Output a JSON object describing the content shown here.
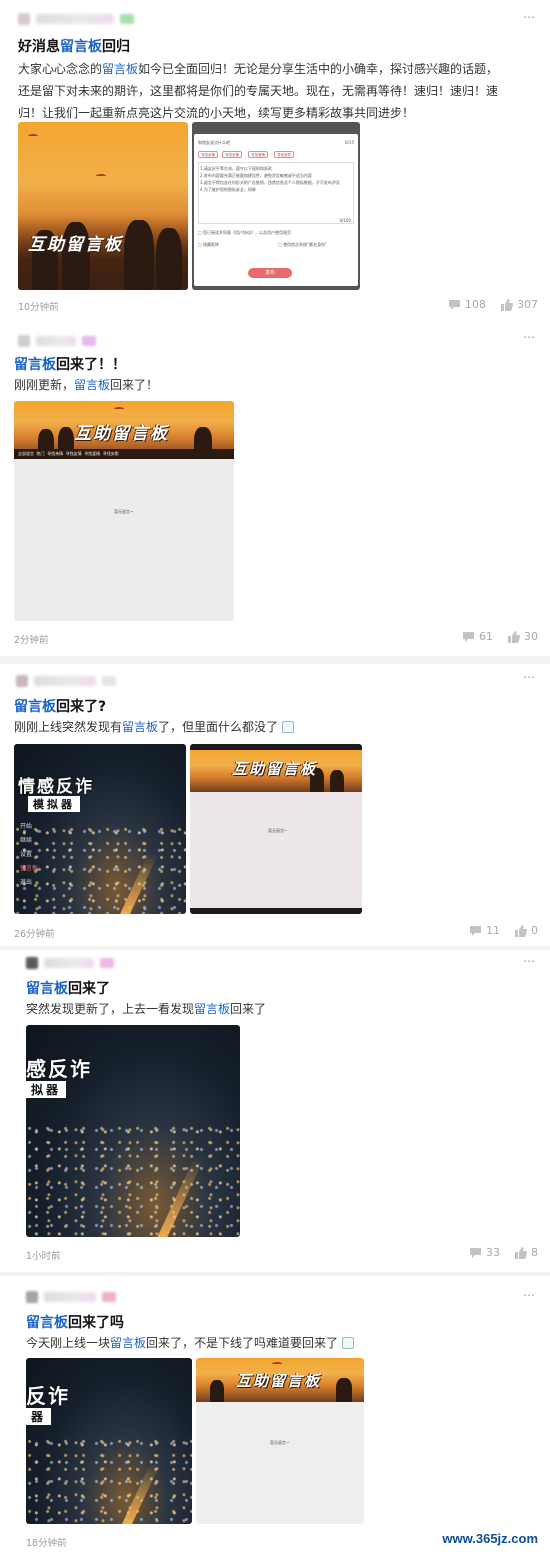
{
  "keyword_color": "#1a63c4",
  "more_icon": "⋯",
  "posts": [
    {
      "title_prefix": "好消息",
      "title_keyword": "留言板",
      "title_suffix": "回归",
      "lines": [
        {
          "a": "大家心心念念的",
          "kw": "留言板",
          "b": "如今已全面回归！无论是分享生活中的小确幸，探讨感兴趣的话题，"
        },
        {
          "a": "还是留下对未来的期许，这里都将是你们的专属天地。现在，无需再等待！速归！速归！速",
          "kw": "",
          "b": ""
        },
        {
          "a": "归！让我们一起重新点亮这片交流的小天地，续写更多精彩故事共同进步！",
          "kw": "",
          "b": ""
        }
      ],
      "images": {
        "poster_text": "互助留言板",
        "form": {
          "placeholder": "和朋友说点什么吧",
          "counter": "0/15",
          "tags": [
            "寻找亲情",
            "寻找友情",
            "寻找爱情",
            "寻找安慰"
          ],
          "text_lines": [
            "1.请友好平等交流，遵守以下规则和条款",
            "2.发布内容要充满正能量和建设性，避免涉及敏感或不适当内容",
            "3.留言不得包含任何形式的广告推销，违禁信息及个人隐私数据，不可发布涉及",
            "4.为了维护您的隐私安全，如果"
          ],
          "char_count": "0/100",
          "note": "□ 您已阅读并同意《用户协议》，以及用户使用规范",
          "anon_label": "□ 允许看到",
          "checkbox_1": "隐藏昵称",
          "checkbox_2": "使用首次系统“匿名身份”",
          "submit": "发布"
        }
      },
      "time": "10分钟前",
      "comments": "108",
      "likes": "307"
    },
    {
      "title_prefix": "",
      "title_keyword": "留言板",
      "title_suffix": "回来了！！",
      "lines": [
        {
          "a": "刚刚更新，",
          "kw": "留言板",
          "b": "回来了！"
        }
      ],
      "images": {
        "poster_text": "互助留言板",
        "tabs": [
          "全部留言",
          "热门",
          "寻找亲情",
          "寻找友情",
          "寻找爱情",
          "寻找安慰"
        ],
        "empty": "暂无留言~"
      },
      "time": "2分钟前",
      "comments": "61",
      "likes": "30"
    },
    {
      "title_prefix": "",
      "title_keyword": "留言板",
      "title_suffix": "回来了?",
      "lines": [
        {
          "a": "刚刚上线突然发现有",
          "kw": "留言板",
          "b": "了，但里面什么都没了"
        }
      ],
      "images": {
        "night_title": "情感反诈",
        "night_sub": "模拟器",
        "menu": [
          "开始",
          "继续",
          "设置",
          "留言板",
          "退出"
        ],
        "poster_text": "互助留言板",
        "empty": "暂无留言~"
      },
      "time": "26分钟前",
      "comments": "11",
      "likes": "0"
    },
    {
      "title_prefix": "",
      "title_keyword": "留言板",
      "title_suffix": "回来了",
      "lines": [
        {
          "a": "突然发现更新了，上去一看发现",
          "kw": "留言板",
          "b": "回来了"
        }
      ],
      "images": {
        "night_title": "感反诈",
        "night_sub": "拟器"
      },
      "time": "1小时前",
      "comments": "33",
      "likes": "8"
    },
    {
      "title_prefix": "",
      "title_keyword": "留言板",
      "title_suffix": "回来了吗",
      "lines": [
        {
          "a": "今天刚上线一块",
          "kw": "留言板",
          "b": "回来了，不是下线了吗难道要回来了"
        }
      ],
      "images": {
        "night_title": "反诈",
        "night_sub": "器",
        "poster_text": "互助留言板",
        "empty": "暂无留言~"
      },
      "time": "18分钟前",
      "comments": "",
      "likes": ""
    }
  ],
  "watermark": "www.365jz.com"
}
